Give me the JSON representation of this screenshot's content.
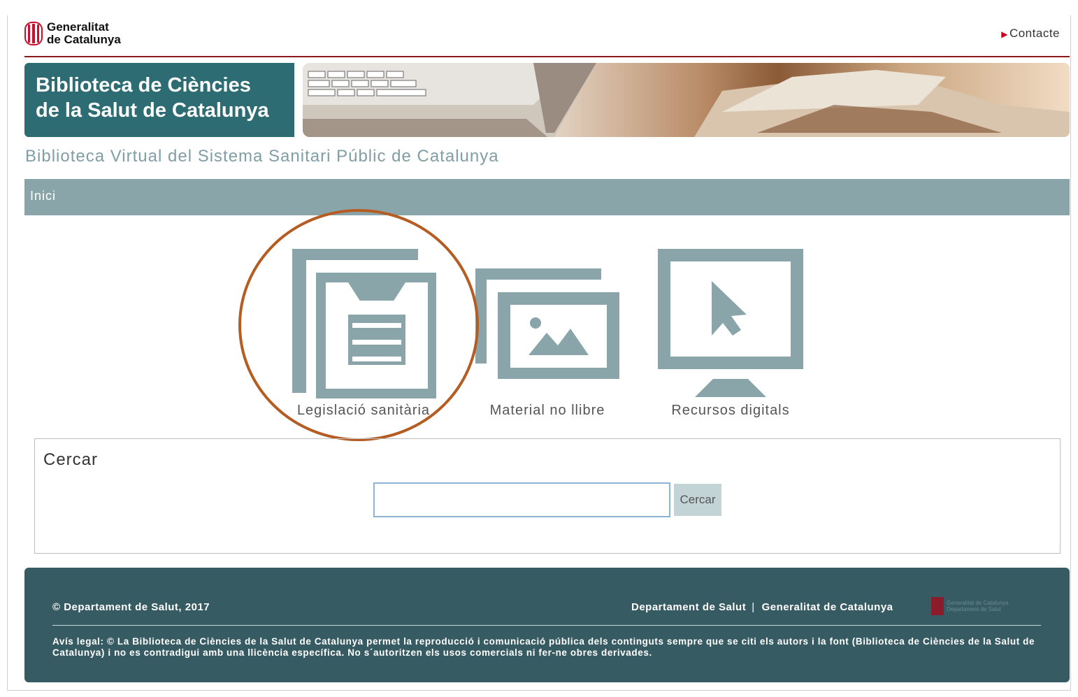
{
  "header": {
    "gov_name_line1": "Generalitat",
    "gov_name_line2": "de Catalunya",
    "contact_label": "Contacte"
  },
  "banner": {
    "title_line1": "Biblioteca de Ciències",
    "title_line2": "de la Salut de Catalunya"
  },
  "subtitle": "Biblioteca Virtual del Sistema Sanitari Públic de Catalunya",
  "nav": {
    "home_label": "Inici"
  },
  "tiles": [
    {
      "label": "Legislació sanitària",
      "icon": "document-icon"
    },
    {
      "label": "Material no llibre",
      "icon": "image-icon"
    },
    {
      "label": "Recursos digitals",
      "icon": "monitor-cursor-icon"
    }
  ],
  "search": {
    "heading": "Cercar",
    "input_value": "",
    "button_label": "Cercar"
  },
  "footer": {
    "copyright": "© Departament de Salut, 2017",
    "link_dept": "Departament de Salut",
    "link_gen": "Generalitat de Catalunya",
    "logo_line1": "Generalitat de Catalunya",
    "logo_line2": "Departament de Salut",
    "legal_label": "Avís legal:",
    "legal_text": "© La Biblioteca de Ciències de la Salut de Catalunya permet la reproducció i comunicació pública dels continguts sempre que se citi els autors i la font (Biblioteca de Ciències de la Salut de Catalunya) i no es contradigui amb una llicència específica. No s´autoritzen els usos comercials ni fer-ne obres derivades."
  },
  "colors": {
    "brand_red": "#8b1a1a",
    "teal_dark": "#2d6c73",
    "nav_gray": "#8aa5a9",
    "footer_bg": "#375b62",
    "highlight": "#b55c22",
    "icon_gray": "#8aa5a9"
  }
}
